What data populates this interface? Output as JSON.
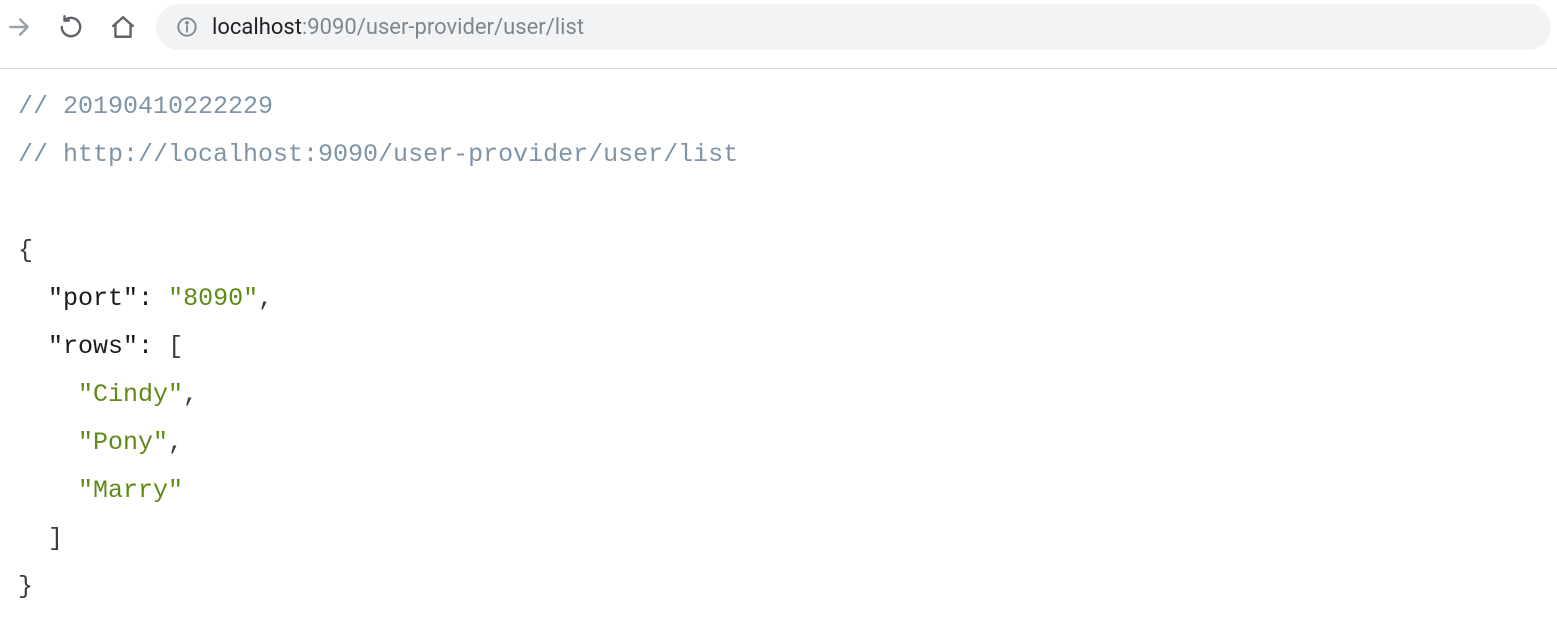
{
  "toolbar": {
    "url_host": "localhost",
    "url_rest": ":9090/user-provider/user/list"
  },
  "comments": {
    "timestamp": "// 20190410222229",
    "url": "// http://localhost:9090/user-provider/user/list"
  },
  "json": {
    "open": "{",
    "close": "}",
    "port_key": "\"port\"",
    "port_value": "\"8090\"",
    "rows_key": "\"rows\"",
    "rows_open": "[",
    "rows_close": "]",
    "rows": [
      "\"Cindy\"",
      "\"Pony\"",
      "\"Marry\""
    ],
    "colon": ":",
    "comma": ","
  },
  "indent": {
    "l1": "  ",
    "l2": "    "
  }
}
